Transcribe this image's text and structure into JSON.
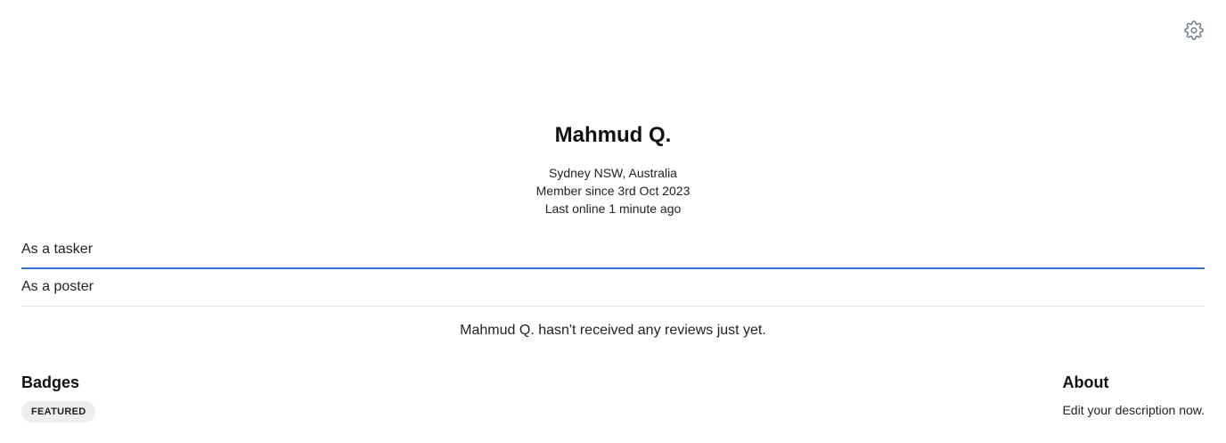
{
  "header": {
    "settings_icon": "gear-icon"
  },
  "profile": {
    "name": "Mahmud Q.",
    "location": "Sydney NSW, Australia",
    "member_since": "Member since 3rd Oct 2023",
    "last_online": "Last online 1 minute ago"
  },
  "tabs": [
    {
      "label": "As a tasker",
      "active": true
    },
    {
      "label": "As a poster",
      "active": false
    }
  ],
  "reviews": {
    "empty_message": "Mahmud Q. hasn't received any reviews just yet."
  },
  "badges": {
    "title": "Badges",
    "items": [
      "FEATURED"
    ]
  },
  "about": {
    "title": "About",
    "text": "Edit your description now."
  },
  "colors": {
    "accent": "#3b73d4",
    "icon": "#6b7a8c",
    "badge_bg": "#eeeeee"
  }
}
